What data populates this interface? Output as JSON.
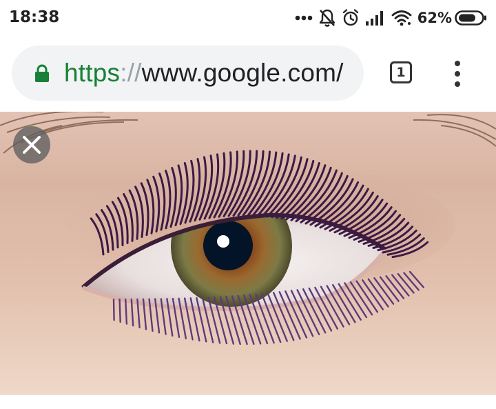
{
  "status_bar": {
    "time": "18:38",
    "icons": [
      "more-dots-icon",
      "notifications-off-icon",
      "alarm-icon",
      "signal-icon",
      "wifi-icon",
      "battery-icon"
    ],
    "battery_percent": "62%"
  },
  "browser": {
    "url_scheme": "https",
    "url_separator": "://",
    "url_host": "www.google.com/",
    "tab_count": "1",
    "accent_color": "#188038"
  },
  "viewer": {
    "image_subject": "eye-with-purple-mascara-photo",
    "close_icon": "close-icon"
  }
}
